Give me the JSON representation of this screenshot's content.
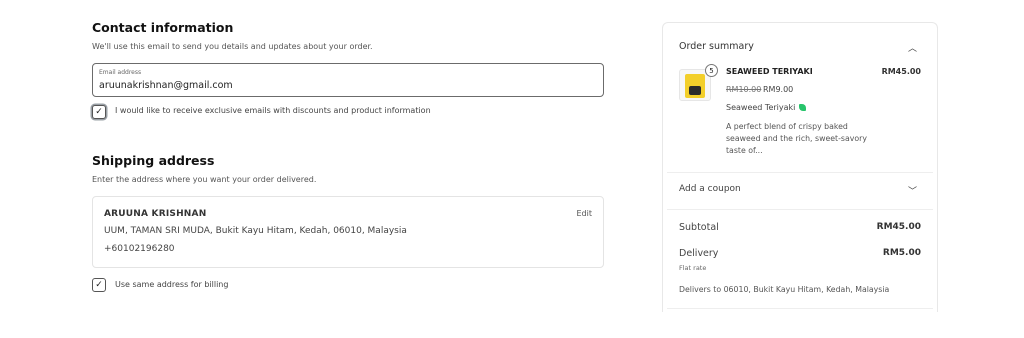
{
  "contact": {
    "title": "Contact information",
    "subtitle": "We'll use this email to send you details and updates about your order.",
    "email_label": "Email address",
    "email_value": "aruunakrishnan@gmail.com",
    "marketing_optin_label": "I would like to receive exclusive emails with discounts and product information",
    "marketing_optin_checked": true
  },
  "shipping": {
    "title": "Shipping address",
    "subtitle": "Enter the address where you want your order delivered.",
    "name": "ARUUNA KRISHNAN",
    "address_line": "UUM, TAMAN SRI MUDA, Bukit Kayu Hitam, Kedah, 06010, Malaysia",
    "phone": "+60102196280",
    "edit_label": "Edit",
    "same_billing_label": "Use same address for billing",
    "same_billing_checked": true
  },
  "summary": {
    "title": "Order summary",
    "item": {
      "quantity": "5",
      "name": "SEAWEED TERIYAKI",
      "line_total": "RM45.00",
      "original_price": "RM10.00",
      "price": "RM9.00",
      "variant": "Seaweed Teriyaki",
      "description": "A perfect blend of crispy baked seaweed and the rich, sweet-savory taste of..."
    },
    "coupon_label": "Add a coupon",
    "subtotal_label": "Subtotal",
    "subtotal_value": "RM45.00",
    "delivery_label": "Delivery",
    "delivery_value": "RM5.00",
    "delivery_method": "Flat rate",
    "delivery_note": "Delivers to 06010, Bukit Kayu Hitam, Kedah, Malaysia"
  },
  "icons": {
    "collapse": "chevron-up-icon",
    "expand": "chevron-down-icon",
    "check": "check-icon",
    "variant": "leaf-icon"
  }
}
